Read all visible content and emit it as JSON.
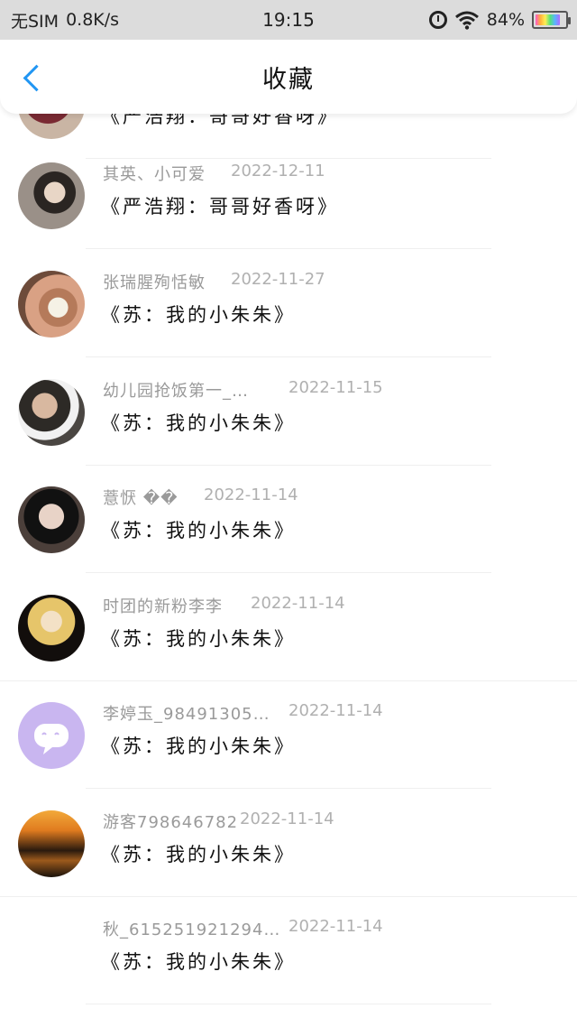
{
  "status_bar": {
    "carrier": "无SIM",
    "speed": "0.8K/s",
    "time": "19:15",
    "battery": "84%",
    "battery_level": 0.84,
    "icons": [
      "alarm-icon",
      "wifi-icon",
      "battery-icon"
    ]
  },
  "header": {
    "title": "收藏",
    "back_icon": "chevron-left-icon",
    "accent_color": "#2196f3"
  },
  "favorites": [
    {
      "name": "",
      "date": "",
      "title": "《严浩翔：哥哥好香呀》"
    },
    {
      "name": "其英、小可爱",
      "date": "2022-12-11",
      "title": "《严浩翔：哥哥好香呀》"
    },
    {
      "name": "张瑞腥殉恬敏",
      "date": "2022-11-27",
      "title": "《苏：我的小朱朱》"
    },
    {
      "name": "幼儿园抢饭第一_…",
      "date": "2022-11-15",
      "title": "《苏：我的小朱朱》"
    },
    {
      "name": "薏恹 ��",
      "date": "2022-11-14",
      "title": "《苏：我的小朱朱》"
    },
    {
      "name": "时团的新粉李李",
      "date": "2022-11-14",
      "title": "《苏：我的小朱朱》"
    },
    {
      "name": "李婷玉_98491305…",
      "date": "2022-11-14",
      "title": "《苏：我的小朱朱》"
    },
    {
      "name": "游客798646782",
      "date": "2022-11-14",
      "title": "《苏：我的小朱朱》"
    },
    {
      "name": "秋_615251921294…",
      "date": "2022-11-14",
      "title": "《苏：我的小朱朱》"
    }
  ]
}
